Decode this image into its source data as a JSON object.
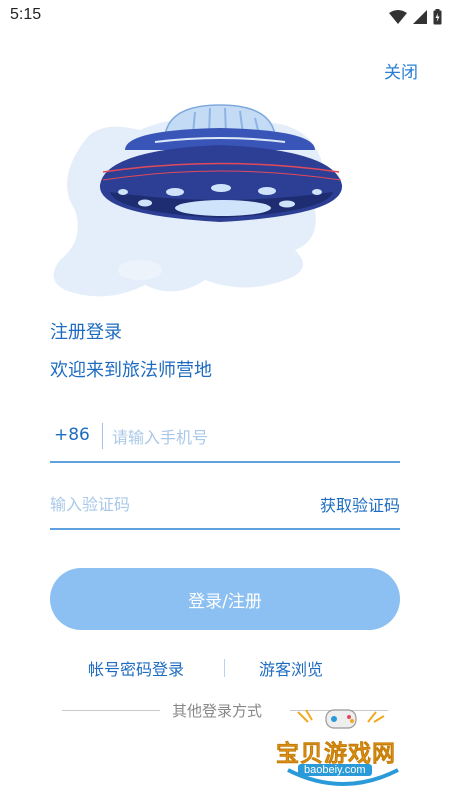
{
  "status_bar": {
    "time": "5:15",
    "icons": [
      "wifi-icon",
      "signal-icon",
      "battery-icon"
    ]
  },
  "header": {
    "close_label": "关闭"
  },
  "illustration": {
    "name": "ufo-illustration",
    "colors": {
      "body": "#2b3d8f",
      "dome": "#bcd9f7",
      "light": "#cfe4fb",
      "splash": "#e3eefb"
    }
  },
  "intro": {
    "title": "注册登录",
    "subtitle": "欢迎来到旅法师营地"
  },
  "form": {
    "country_code": "+86",
    "phone_placeholder": "请输入手机号",
    "phone_value": "",
    "code_placeholder": "输入验证码",
    "code_value": "",
    "get_code_label": "获取验证码",
    "submit_label": "登录/注册"
  },
  "alt_actions": {
    "password_login": "帐号密码登录",
    "guest_browse": "游客浏览"
  },
  "other_login": {
    "label": "其他登录方式"
  },
  "watermark": {
    "title": "宝贝游戏网",
    "url": "baobeiy.com"
  },
  "colors": {
    "accent": "#1e6cc0",
    "button": "#8cc0f2",
    "underline": "#5fa0de",
    "placeholder": "#a9c8e8"
  }
}
